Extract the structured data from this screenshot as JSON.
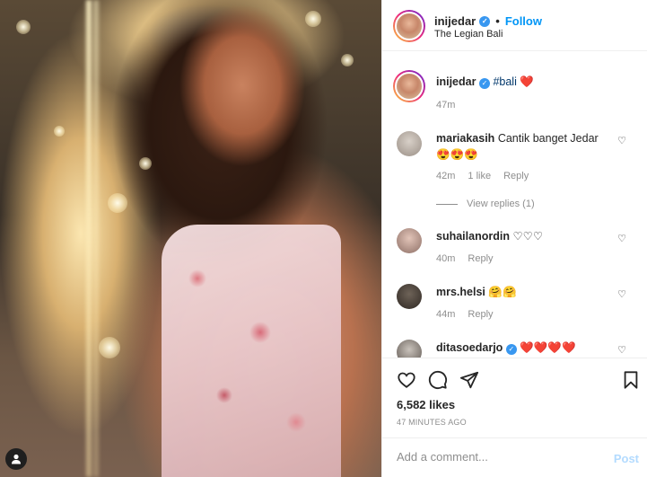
{
  "post": {
    "username": "inijedar",
    "follow_label": "Follow",
    "location": "The Legian Bali",
    "caption_tag": "#bali",
    "caption_emoji": "❤️",
    "caption_time": "47m"
  },
  "comments": [
    {
      "username": "mariakasih",
      "text": "Cantik banget Jedar",
      "emoji": "😍😍😍",
      "time": "42m",
      "likes": "1 like",
      "reply_label": "Reply",
      "view_replies": "View replies (1)"
    },
    {
      "username": "suhailanordin",
      "text": "♡♡♡",
      "time": "40m",
      "reply_label": "Reply"
    },
    {
      "username": "mrs.helsi",
      "text": "🤗🤗",
      "time": "44m",
      "reply_label": "Reply"
    },
    {
      "username": "ditasoedarjo",
      "text": "❤️❤️❤️❤️",
      "time": ""
    }
  ],
  "stats": {
    "likes": "6,582 likes",
    "time_ago": "47 MINUTES AGO"
  },
  "comment_box": {
    "placeholder": "Add a comment...",
    "post_label": "Post"
  },
  "icons": {
    "like": "heart-outline-icon",
    "comment": "speech-bubble-icon",
    "share": "paper-plane-icon",
    "save": "bookmark-icon",
    "verified": "verified-badge-icon",
    "account": "user-icon"
  },
  "colors": {
    "follow_blue": "#0095f6",
    "verified_blue": "#3897f0",
    "heart_red": "#ed4956",
    "post_disabled": "#b3dbff"
  }
}
